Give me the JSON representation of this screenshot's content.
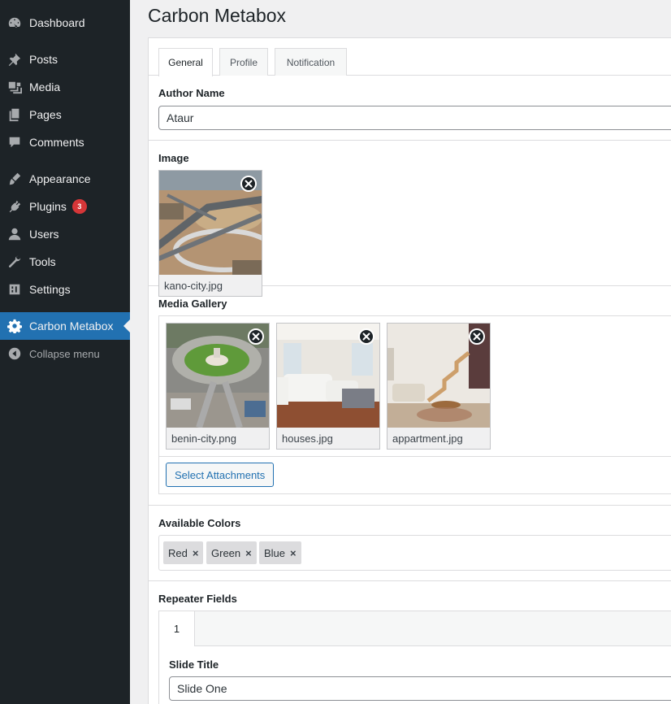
{
  "sidebar": {
    "items": [
      {
        "label": "Dashboard",
        "icon": "dashboard-icon"
      },
      {
        "label": "Posts",
        "icon": "pin-icon"
      },
      {
        "label": "Media",
        "icon": "media-icon"
      },
      {
        "label": "Pages",
        "icon": "pages-icon"
      },
      {
        "label": "Comments",
        "icon": "comment-icon"
      },
      {
        "label": "Appearance",
        "icon": "brush-icon"
      },
      {
        "label": "Plugins",
        "icon": "plugin-icon",
        "badge": "3"
      },
      {
        "label": "Users",
        "icon": "user-icon"
      },
      {
        "label": "Tools",
        "icon": "wrench-icon"
      },
      {
        "label": "Settings",
        "icon": "settings-icon"
      },
      {
        "label": "Carbon Metabox",
        "icon": "gear-icon",
        "active": true
      },
      {
        "label": "Collapse menu",
        "icon": "collapse-icon"
      }
    ]
  },
  "page": {
    "title": "Carbon Metabox"
  },
  "tabs": [
    "General",
    "Profile",
    "Notification"
  ],
  "fields": {
    "author_name": {
      "label": "Author Name",
      "value": "Ataur"
    },
    "image": {
      "label": "Image",
      "filename": "kano-city.jpg"
    },
    "media_gallery": {
      "label": "Media Gallery",
      "items": [
        "benin-city.png",
        "houses.jpg",
        "appartment.jpg"
      ],
      "button": "Select Attachments"
    },
    "available_colors": {
      "label": "Available Colors",
      "chips": [
        "Red",
        "Green",
        "Blue"
      ]
    },
    "repeater": {
      "label": "Repeater Fields",
      "tab": "1",
      "slide_title_label": "Slide Title",
      "slide_title_value": "Slide One"
    }
  },
  "colors": {
    "sidebar_bg": "#1d2327",
    "accent": "#2271b1",
    "badge": "#d63638"
  }
}
